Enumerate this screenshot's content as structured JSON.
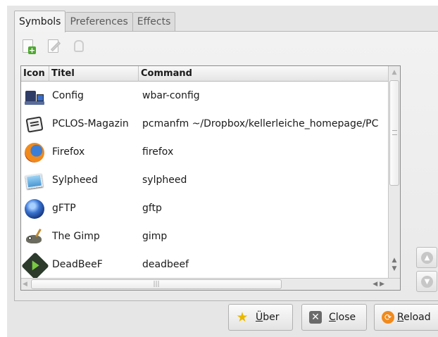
{
  "tabs": [
    {
      "label": "Symbols",
      "active": true
    },
    {
      "label": "Preferences",
      "active": false
    },
    {
      "label": "Effects",
      "active": false
    }
  ],
  "toolbar": {
    "add_icon": "add-document-icon",
    "edit_icon": "edit-pencil-icon",
    "delete_icon": "recycle-bin-icon"
  },
  "table": {
    "columns": [
      "Icon",
      "Titel",
      "Command"
    ],
    "rows": [
      {
        "icon": "config-icon",
        "title": "Config",
        "command": "wbar-config"
      },
      {
        "icon": "pclos-magazine-icon",
        "title": "PCLOS-Magazin",
        "command": "pcmanfm ~/Dropbox/kellerleiche_homepage/PC"
      },
      {
        "icon": "firefox-icon",
        "title": "Firefox",
        "command": "firefox"
      },
      {
        "icon": "sylpheed-icon",
        "title": "Sylpheed",
        "command": "sylpheed"
      },
      {
        "icon": "gftp-icon",
        "title": "gFTP",
        "command": "gftp"
      },
      {
        "icon": "gimp-icon",
        "title": "The Gimp",
        "command": "gimp"
      },
      {
        "icon": "deadbeef-icon",
        "title": "DeadBeeF",
        "command": "deadbeef"
      }
    ]
  },
  "side_buttons": {
    "up_icon": "move-up-icon",
    "down_icon": "move-down-icon"
  },
  "buttons": {
    "about": {
      "accel": "Ü",
      "rest": "ber",
      "icon": "star-icon"
    },
    "close": {
      "accel": "C",
      "rest": "lose",
      "icon": "close-icon"
    },
    "reload": {
      "accel": "R",
      "rest": "eload",
      "icon": "reload-icon"
    }
  },
  "colors": {
    "window_bg": "#e6e6e6",
    "list_bg": "#ffffff"
  }
}
